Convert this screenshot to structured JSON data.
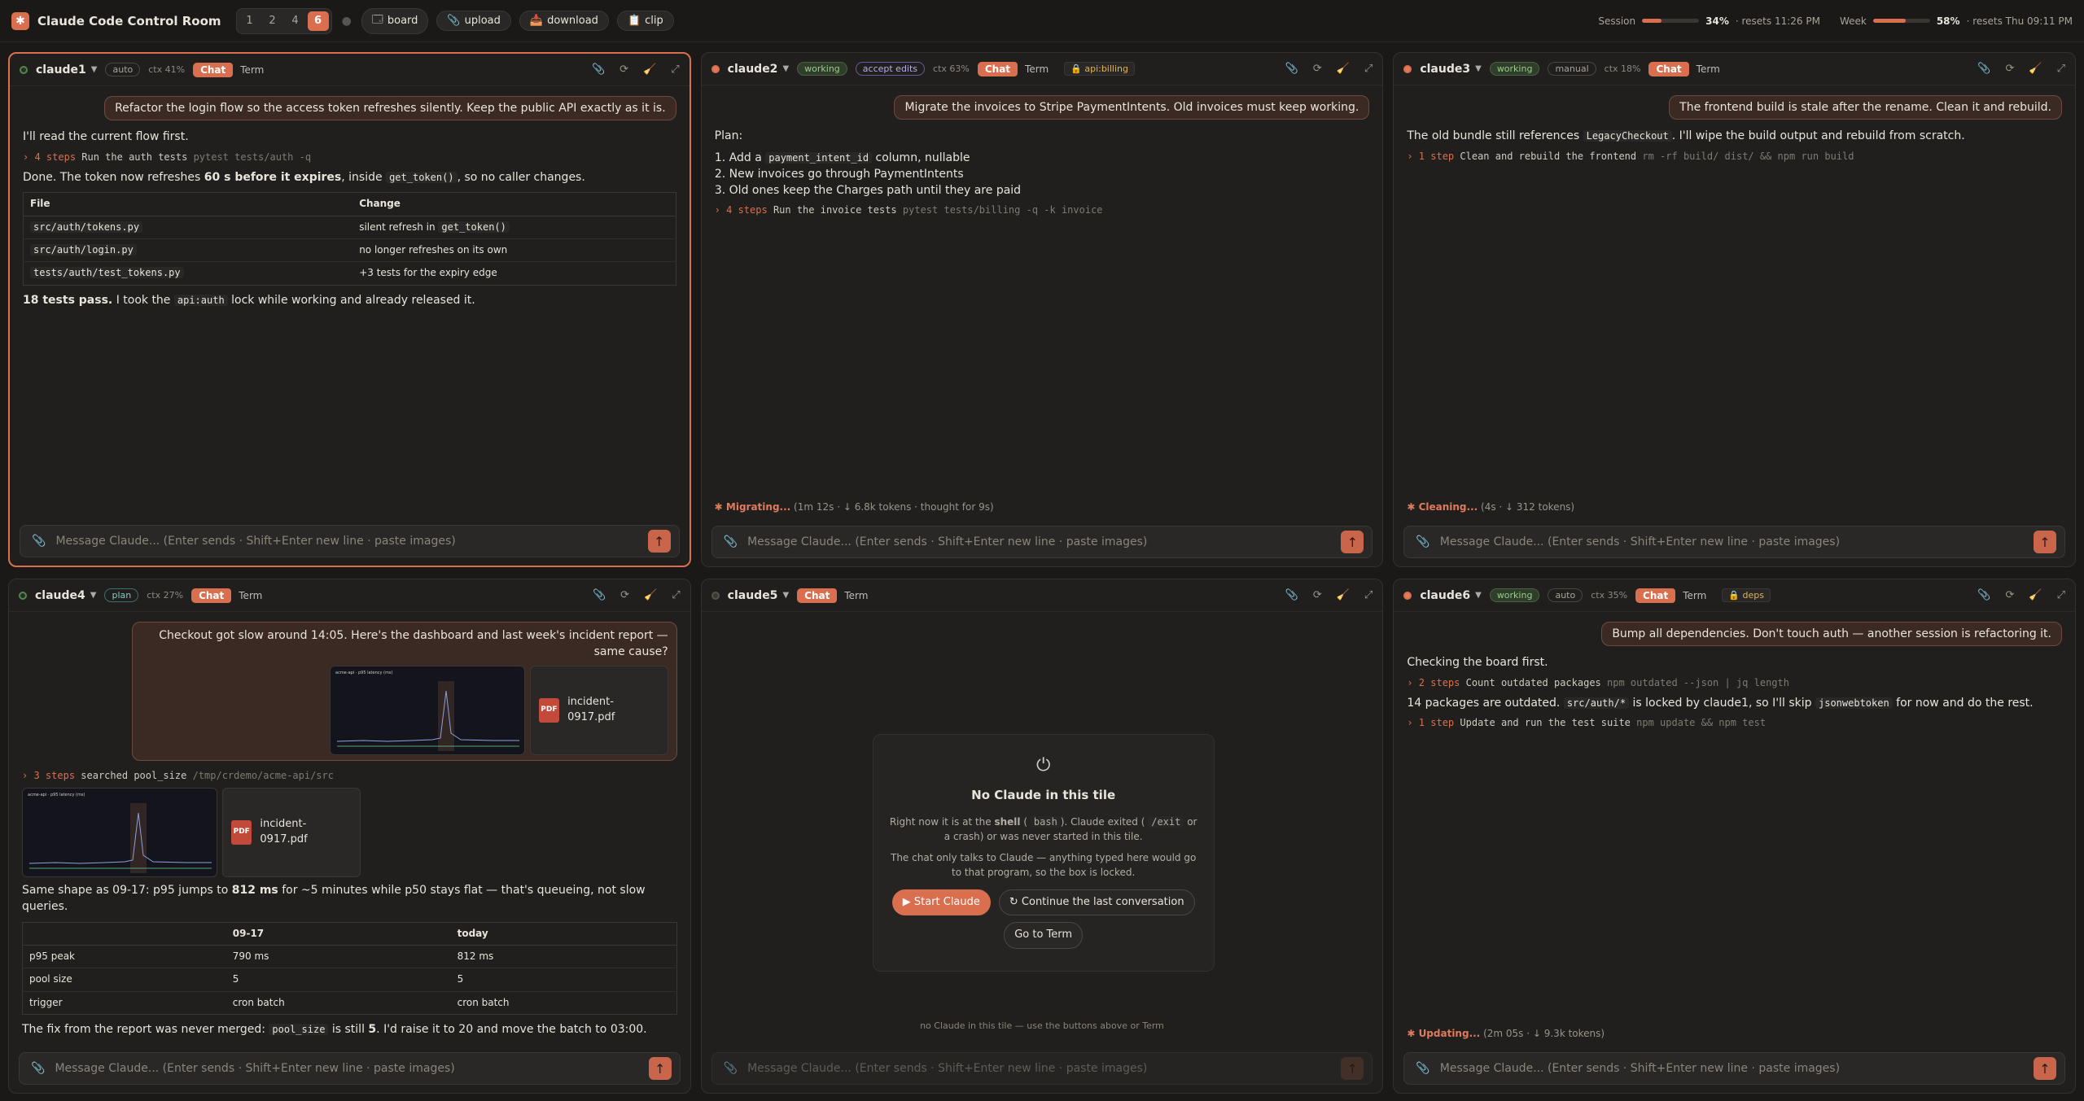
{
  "app": {
    "title": "Claude Code Control Room",
    "logo": "✱",
    "layouts": [
      "1",
      "2",
      "4",
      "6"
    ],
    "active_layout": "6",
    "buttons": {
      "board": "board",
      "upload": "upload",
      "download": "download",
      "clip": "clip"
    },
    "session": {
      "label": "Session",
      "pct": 34,
      "pct_text": "34%",
      "reset": "· resets 11:26 PM"
    },
    "week": {
      "label": "Week",
      "pct": 58,
      "pct_text": "58%",
      "reset": "· resets Thu 09:11 PM"
    }
  },
  "common": {
    "chat": "Chat",
    "term": "Term",
    "placeholder": "Message Claude...  (Enter sends · Shift+Enter new line · paste images)"
  },
  "t1": {
    "name": "claude1",
    "mode": "auto",
    "ctx": "ctx 41%",
    "user": "Refactor the login flow so the access token refreshes silently. Keep the public API exactly as it is.",
    "p1": "I'll read the current flow first.",
    "step": {
      "n": "4 steps",
      "label": "Run the auth tests",
      "cmd": "pytest tests/auth -q"
    },
    "p2a": "Done. The token now refreshes",
    "p2b": "60 s before it expires",
    "p2c": ", inside",
    "p2code": "get_token()",
    "p2d": ", so no caller changes.",
    "table": {
      "h": [
        "File",
        "Change"
      ],
      "rows": [
        [
          "src/auth/tokens.py",
          "silent refresh in",
          "get_token()"
        ],
        [
          "src/auth/login.py",
          "no longer refreshes on its own",
          ""
        ],
        [
          "tests/auth/test_tokens.py",
          "+3 tests for the expiry edge",
          ""
        ]
      ]
    },
    "p3a": "18 tests pass.",
    "p3b": "I took the",
    "p3code": "api:auth",
    "p3c": "lock while working and already released it."
  },
  "t2": {
    "name": "claude2",
    "state": "working",
    "mode": "accept edits",
    "ctx": "ctx 63%",
    "lock": "api:billing",
    "user": "Migrate the invoices to Stripe PaymentIntents. Old invoices must keep working.",
    "plan": "Plan:",
    "i1a": "Add a",
    "i1code": "payment_intent_id",
    "i1b": "column, nullable",
    "i2": "New invoices go through PaymentIntents",
    "i3": "Old ones keep the Charges path until they are paid",
    "step": {
      "n": "4 steps",
      "label": "Run the invoice tests",
      "cmd": "pytest tests/billing -q -k invoice"
    },
    "status": {
      "label": "Migrating...",
      "info": "(1m 12s · ↓ 6.8k tokens · thought for 9s)"
    }
  },
  "t3": {
    "name": "claude3",
    "state": "working",
    "mode": "manual",
    "ctx": "ctx 18%",
    "user": "The frontend build is stale after the rename. Clean it and rebuild.",
    "p1a": "The old bundle still references",
    "p1code": "LegacyCheckout",
    "p1b": ". I'll wipe the build output and rebuild from scratch.",
    "step": {
      "n": "1 step",
      "label": "Clean and rebuild the frontend",
      "cmd": "rm -rf build/ dist/ && npm run build"
    },
    "status": {
      "label": "Cleaning...",
      "info": "(4s · ↓ 312 tokens)"
    }
  },
  "t4": {
    "name": "claude4",
    "mode": "plan",
    "ctx": "ctx 27%",
    "user": "Checkout got slow around 14:05. Here's the dashboard and last week's incident report — same cause?",
    "pdf": "incident-0917.pdf",
    "pdficon": "PDF",
    "thumbtitle": "acme-api · p95 latency (ms)",
    "step": {
      "n": "3 steps",
      "label": "searched",
      "mid": "pool_size",
      "cmd": "/tmp/crdemo/acme-api/src"
    },
    "p1a": "Same shape as 09-17: p95 jumps to",
    "p1b": "812 ms",
    "p1c": "for ~5 minutes while p50 stays flat — that's queueing, not slow queries.",
    "table": {
      "h": [
        "",
        "09-17",
        "today"
      ],
      "rows": [
        [
          "p95 peak",
          "790 ms",
          "812 ms"
        ],
        [
          "pool size",
          "5",
          "5"
        ],
        [
          "trigger",
          "cron batch",
          "cron batch"
        ]
      ]
    },
    "p2a": "The fix from the report was never merged:",
    "p2code": "pool_size",
    "p2b": "is still",
    "p2c": "5",
    "p2d": ". I'd raise it to 20 and move the batch to 03:00."
  },
  "t5": {
    "name": "claude5",
    "title": "No Claude in this tile",
    "d1a": "Right now it is at the",
    "d1b": "shell",
    "d1c": "(",
    "d1code": "bash",
    "d1d": "). Claude exited (",
    "d1code2": "/exit",
    "d1e": "or a crash) or was never started in this tile.",
    "d2": "The chat only talks to Claude — anything typed here would go to that program, so the box is locked.",
    "start": "▶ Start Claude",
    "cont": "↻ Continue the last conversation",
    "goterm": "Go to Term",
    "hint": "no Claude in this tile — use the buttons above or Term"
  },
  "t6": {
    "name": "claude6",
    "state": "working",
    "mode": "auto",
    "ctx": "ctx 35%",
    "lock": "deps",
    "user": "Bump all dependencies. Don't touch auth — another session is refactoring it.",
    "p1": "Checking the board first.",
    "step1": {
      "n": "2 steps",
      "label": "Count outdated packages",
      "cmd": "npm outdated --json | jq length"
    },
    "p2a": "14 packages are outdated.",
    "p2code": "src/auth/*",
    "p2b": "is locked by claude1, so I'll skip",
    "p2code2": "jsonwebtoken",
    "p2c": "for now and do the rest.",
    "step2": {
      "n": "1 step",
      "label": "Update and run the test suite",
      "cmd": "npm update && npm test"
    },
    "status": {
      "label": "Updating...",
      "info": "(2m 05s · ↓ 9.3k tokens)"
    }
  }
}
